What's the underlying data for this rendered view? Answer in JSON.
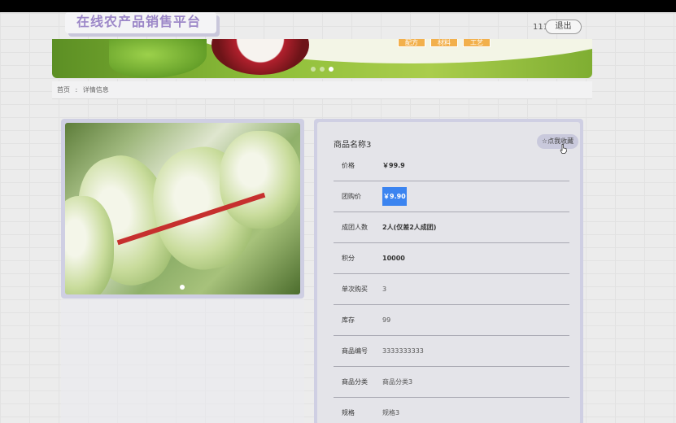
{
  "header": {
    "site_title": "在线农产品销售平台",
    "user_name": "111",
    "logout_label": "退出"
  },
  "banner": {
    "tags": [
      "配方",
      "材料",
      "工艺"
    ]
  },
  "breadcrumb": {
    "home": "首页",
    "separator": ":",
    "current": "详情信息"
  },
  "product": {
    "name": "商品名称3",
    "favorite_label": "☆点我收藏",
    "fields": [
      {
        "label": "价格",
        "value": "￥99.9",
        "style": "bold"
      },
      {
        "label": "团购价",
        "value": "￥9.90",
        "style": "highlight"
      },
      {
        "label": "成团人数",
        "value": "2人(仅差2人成团)",
        "style": "bold"
      },
      {
        "label": "积分",
        "value": "10000",
        "style": "bold"
      },
      {
        "label": "单次购买",
        "value": "3",
        "style": "normal"
      },
      {
        "label": "库存",
        "value": "99",
        "style": "normal"
      },
      {
        "label": "商品编号",
        "value": "3333333333",
        "style": "normal"
      },
      {
        "label": "商品分类",
        "value": "商品分类3",
        "style": "normal"
      },
      {
        "label": "规格",
        "value": "规格3",
        "style": "normal"
      }
    ]
  },
  "colors": {
    "title_purple": "#9c87c8",
    "card_border": "#cfcfe3",
    "highlight_blue": "#3b84f0",
    "tag_orange": "#f2b04c"
  }
}
